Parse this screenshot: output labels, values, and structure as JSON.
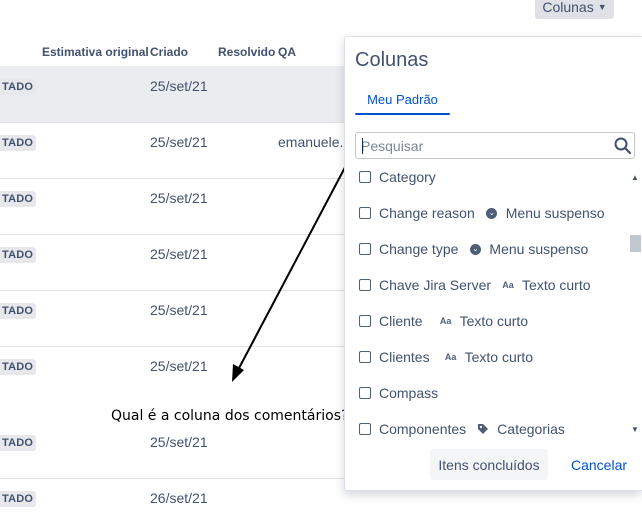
{
  "toolbar": {
    "columns_button_label": "Colunas"
  },
  "table": {
    "headers": [
      "Estimativa original",
      "Criado",
      "Resolvido",
      "QA"
    ],
    "rows": [
      {
        "status": "TADO",
        "created": "25/set/21",
        "qa": ""
      },
      {
        "status": "TADO",
        "created": "25/set/21",
        "qa": "emanuele."
      },
      {
        "status": "TADO",
        "created": "25/set/21",
        "qa": ""
      },
      {
        "status": "TADO",
        "created": "25/set/21",
        "qa": ""
      },
      {
        "status": "TADO",
        "created": "25/set/21",
        "qa": ""
      },
      {
        "status": "TADO",
        "created": "25/set/21",
        "qa": ""
      },
      {
        "status": "TADO",
        "created": "25/set/21",
        "qa": ""
      },
      {
        "status": "TADO",
        "created": "26/set/21",
        "qa": ""
      }
    ]
  },
  "annotation": {
    "question": "Qual é a coluna dos comentários?"
  },
  "columns_panel": {
    "title": "Colunas",
    "tab_label": "Meu Padrão",
    "search_placeholder": "Pesquisar",
    "items": [
      {
        "label": "Category",
        "type": "",
        "icon": ""
      },
      {
        "label": "Change reason",
        "type": "Menu suspenso",
        "icon": "dropdown-icon"
      },
      {
        "label": "Change type",
        "type": "Menu suspenso",
        "icon": "dropdown-icon"
      },
      {
        "label": "Chave Jira Server",
        "type": "Texto curto",
        "icon": "short-text-icon"
      },
      {
        "label": "Cliente",
        "type": "Texto curto",
        "icon": "short-text-icon"
      },
      {
        "label": "Clientes",
        "type": "Texto curto",
        "icon": "short-text-icon"
      },
      {
        "label": "Compass",
        "type": "",
        "icon": ""
      },
      {
        "label": "Componentes",
        "type": "Categorias",
        "icon": "tag-icon"
      }
    ],
    "short_text_glyph": "Aa",
    "done_button_label": "Itens concluídos",
    "cancel_button_label": "Cancelar"
  },
  "colors": {
    "accent": "#0052cc",
    "selected_row": "#ebecf0",
    "text": "#42526e"
  }
}
